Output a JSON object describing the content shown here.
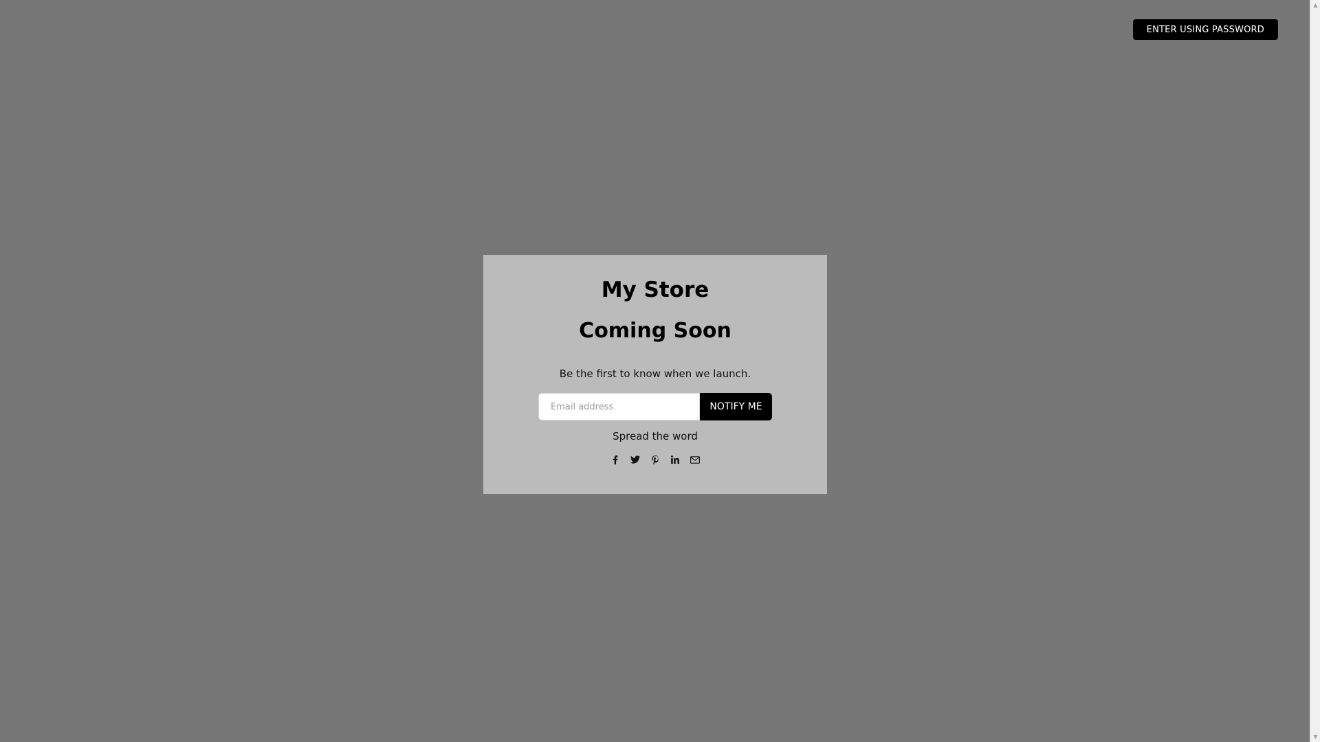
{
  "header": {
    "enter_password_label": "ENTER USING PASSWORD"
  },
  "card": {
    "store_name": "My Store",
    "heading": "Coming Soon",
    "tagline": "Be the first to know when we launch.",
    "email_placeholder": "Email address",
    "email_value": "",
    "notify_label": "NOTIFY ME",
    "spread_label": "Spread the word",
    "share_icons": [
      "facebook-icon",
      "twitter-icon",
      "pinterest-icon",
      "linkedin-icon",
      "email-icon"
    ]
  },
  "colors": {
    "page_background": "#777777",
    "card_background": "#bbbbbb",
    "button_background": "#000000",
    "button_text": "#ffffff",
    "text": "#000000"
  }
}
